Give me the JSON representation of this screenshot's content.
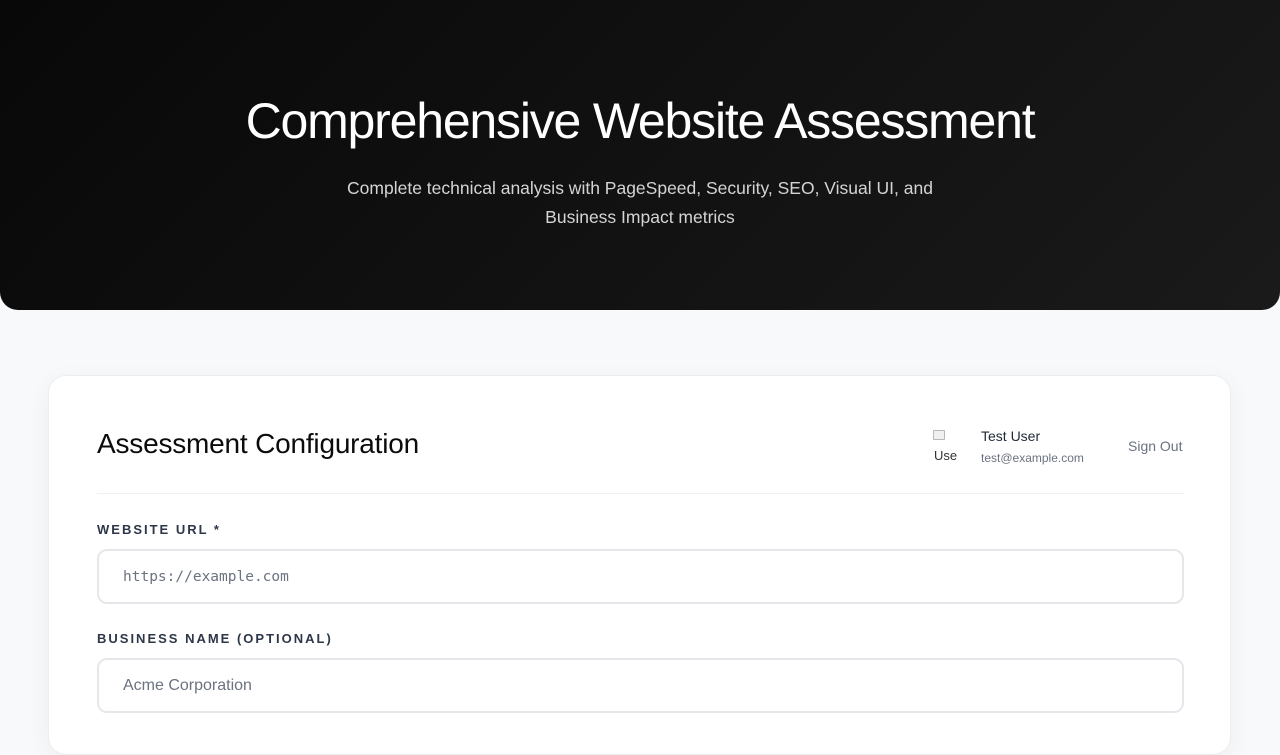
{
  "hero": {
    "title": "Comprehensive Website Assessment",
    "subtitle": "Complete technical analysis with PageSpeed, Security, SEO, Visual UI, and Business Impact metrics"
  },
  "config": {
    "title": "Assessment Configuration",
    "user": {
      "avatar_alt": "Use",
      "name": "Test User",
      "email": "test@example.com"
    },
    "sign_out_label": "Sign Out",
    "website_url": {
      "label": "Website URL *",
      "placeholder": "https://example.com",
      "value": ""
    },
    "business_name": {
      "label": "Business Name (Optional)",
      "placeholder": "Acme Corporation",
      "value": ""
    }
  },
  "colors": {
    "hero_bg": "#0d0d0d",
    "page_bg": "#f8f9fb",
    "card_bg": "#ffffff",
    "label_text": "#2d3748",
    "muted_text": "#6b7280"
  },
  "icons": {
    "avatar": "broken-image-avatar"
  }
}
